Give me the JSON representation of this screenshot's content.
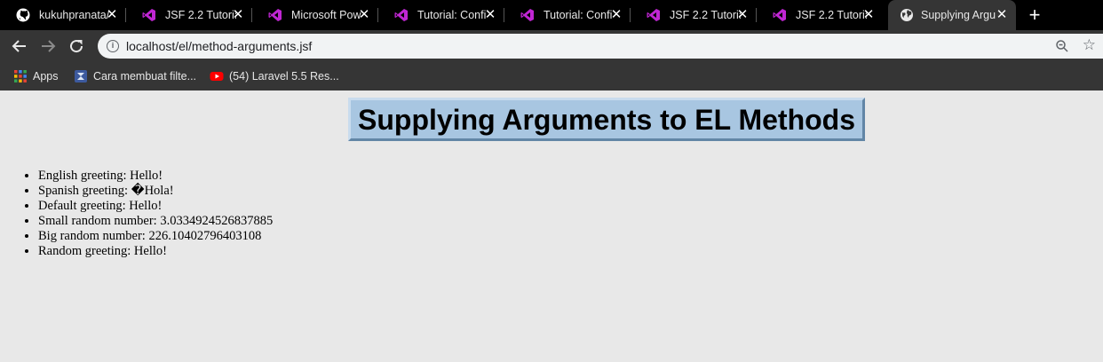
{
  "tabs": [
    {
      "title": "kukuhpranata/",
      "icon": "github-icon",
      "active": false
    },
    {
      "title": "JSF 2.2 Tutorial",
      "icon": "visual-studio-icon",
      "active": false
    },
    {
      "title": "Microsoft Pow",
      "icon": "visual-studio-icon",
      "active": false
    },
    {
      "title": "Tutorial: Confi",
      "icon": "visual-studio-icon",
      "active": false
    },
    {
      "title": "Tutorial: Confi",
      "icon": "visual-studio-icon",
      "active": false
    },
    {
      "title": "JSF 2.2 Tutorial",
      "icon": "visual-studio-icon",
      "active": false
    },
    {
      "title": "JSF 2.2 Tutoria",
      "icon": "visual-studio-icon",
      "active": false
    },
    {
      "title": "Supplying Argu",
      "icon": "globe-icon",
      "active": true
    }
  ],
  "toolbar": {
    "url": "localhost/el/method-arguments.jsf"
  },
  "bookmarks": [
    {
      "label": "Apps",
      "icon": "apps-grid-icon"
    },
    {
      "label": "Cara membuat filte...",
      "icon": "bookmark-site-icon"
    },
    {
      "label": "(54) Laravel 5.5 Res...",
      "icon": "youtube-icon"
    }
  ],
  "page": {
    "heading": "Supplying Arguments to EL Methods",
    "items": [
      "English greeting: Hello!",
      "Spanish greeting: �Hola!",
      "Default greeting: Hello!",
      "Small random number: 3.0334924526837885",
      "Big random number: 226.10402796403108",
      "Random greeting: Hello!"
    ]
  },
  "colors": {
    "heading_bg": "#a8c6e1",
    "page_bg": "#e8e8e8",
    "tab_accent": "#c026d3"
  }
}
